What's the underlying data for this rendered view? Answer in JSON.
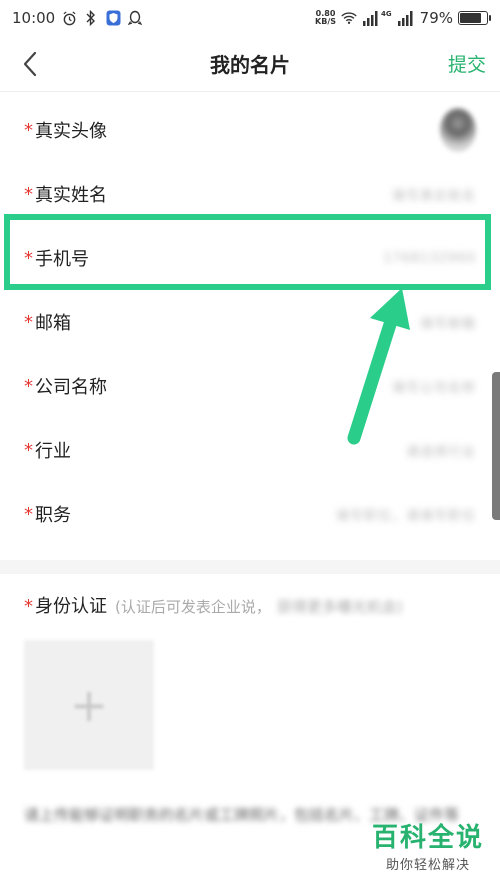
{
  "status_bar": {
    "time": "10:00",
    "net_speed_value": "0.80",
    "net_speed_unit": "KB/S",
    "signal_label": "4G",
    "battery_percent": "79%",
    "battery_level": 0.79
  },
  "nav": {
    "title": "我的名片",
    "submit_label": "提交"
  },
  "form": {
    "required_mark": "*",
    "rows": [
      {
        "label": "真实头像"
      },
      {
        "label": "真实姓名",
        "value": "填写真实姓名"
      },
      {
        "label": "手机号",
        "value": "1768132960"
      },
      {
        "label": "邮箱",
        "value": "填写邮箱"
      },
      {
        "label": "公司名称",
        "value": "填写公司名称"
      },
      {
        "label": "行业",
        "value": "请选择行业"
      },
      {
        "label": "职务",
        "value": "填写职位，请填写职位"
      }
    ]
  },
  "identity": {
    "title": "身份认证",
    "hint": "(认证后可发表企业说，",
    "hint_tail": "获得更多曝光机会)",
    "upload_plus": "+",
    "description": "请上传能够证明职务的名片或工牌照片，包括名片、工牌、证件等"
  },
  "watermark": {
    "main": "百科全说",
    "sub": "助你轻松解决"
  },
  "colors": {
    "accent": "#27b36f",
    "highlight": "#2bcd8a",
    "required": "#e53935"
  }
}
